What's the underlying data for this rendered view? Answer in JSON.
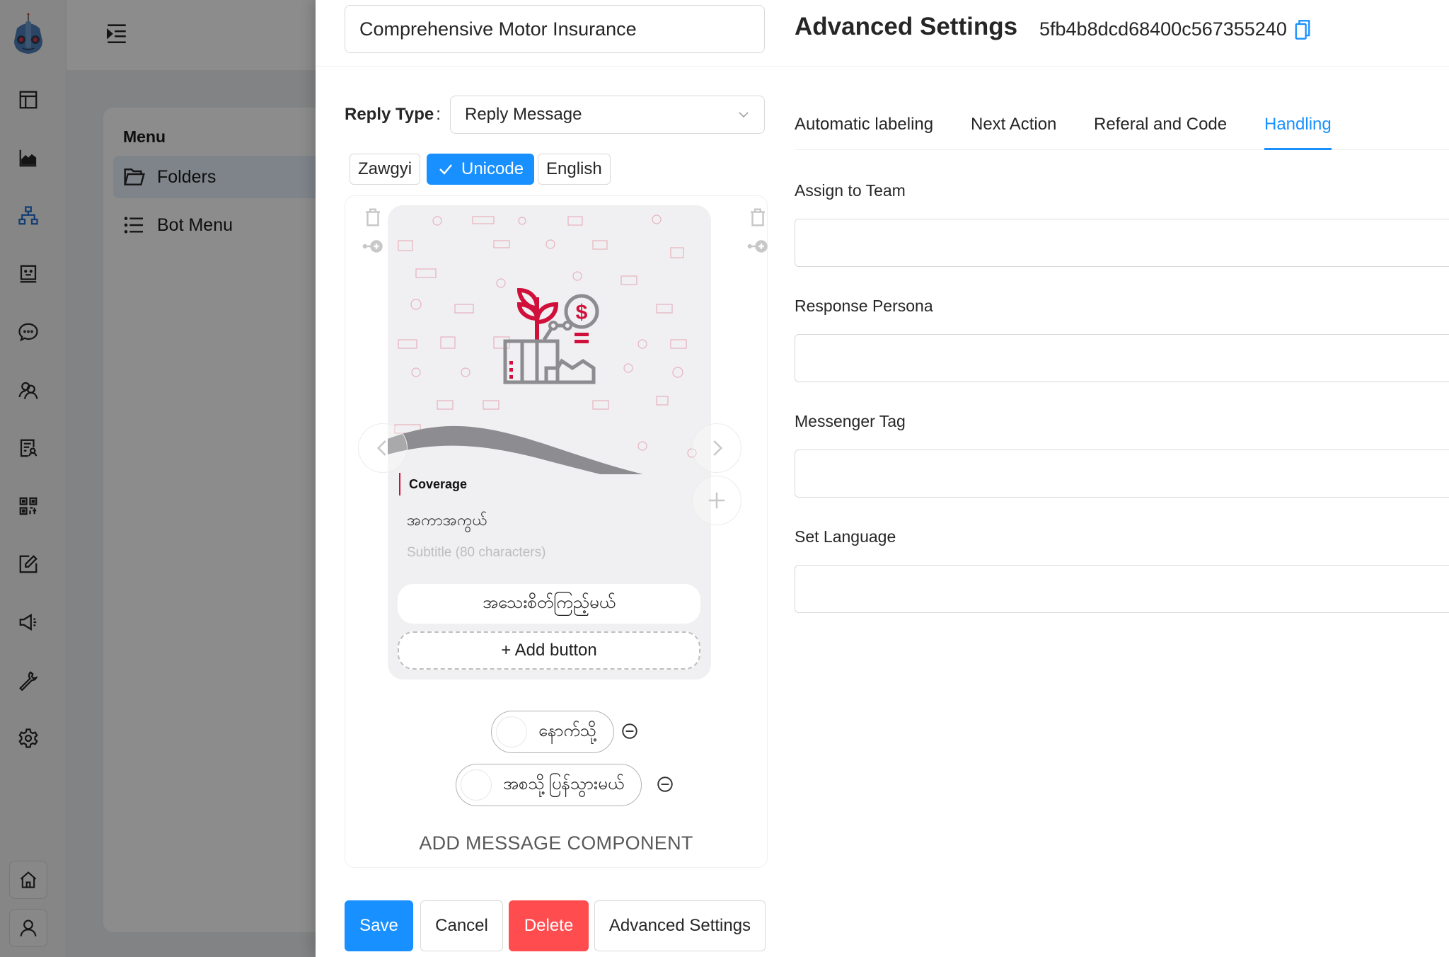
{
  "sidebar": {
    "logo": "robot-logo",
    "icons": [
      "layout-icon",
      "area-chart-icon",
      "flow-tree-icon",
      "bot-face-icon",
      "chat-icon",
      "users-icon",
      "contact-list-icon",
      "qrcode-icon",
      "edit-icon",
      "broadcast-icon",
      "tool-icon",
      "settings-icon"
    ],
    "bottom": [
      "home-icon",
      "user-icon"
    ]
  },
  "menu": {
    "title": "Menu",
    "items": [
      {
        "label": "Folders",
        "icon": "folder-open-icon",
        "active": true
      },
      {
        "label": "Bot Menu",
        "icon": "list-icon",
        "active": false
      }
    ]
  },
  "editor": {
    "name_value": "Comprehensive Motor Insurance",
    "reply_type_label": "Reply Type",
    "reply_type_colon": ":",
    "reply_type_value": "Reply Message",
    "languages": [
      {
        "label": "Zawgyi",
        "selected": false
      },
      {
        "label": "Unicode",
        "selected": true
      },
      {
        "label": "English",
        "selected": false
      }
    ],
    "card": {
      "title": "Coverage",
      "subtitle_value": "အကာအကွယ်",
      "subtitle_placeholder": "Subtitle (80 characters)",
      "buttons": [
        "အသေးစိတ်ကြည့်မယ်"
      ],
      "add_button_label": "+ Add button"
    },
    "quick_replies": [
      "နောက်သို့",
      "အစသို့ပြန်သွားမယ်"
    ],
    "add_component_label": "ADD MESSAGE COMPONENT"
  },
  "footer": {
    "save": "Save",
    "cancel": "Cancel",
    "delete": "Delete",
    "advanced": "Advanced Settings"
  },
  "advanced": {
    "title": "Advanced Settings",
    "id": "5fb4b8dcd68400c567355240",
    "tabs": [
      {
        "label": "Automatic labeling",
        "active": false
      },
      {
        "label": "Next Action",
        "active": false
      },
      {
        "label": "Referal and Code",
        "active": false
      },
      {
        "label": "Handling",
        "active": true
      }
    ],
    "fields": [
      {
        "label": "Assign to Team",
        "value": ""
      },
      {
        "label": "Response Persona",
        "value": ""
      },
      {
        "label": "Messenger Tag",
        "value": ""
      },
      {
        "label": "Set Language",
        "value": ""
      }
    ]
  },
  "colors": {
    "primary": "#1890ff",
    "danger": "#ff4d4f",
    "brand_red": "#d0103a"
  }
}
